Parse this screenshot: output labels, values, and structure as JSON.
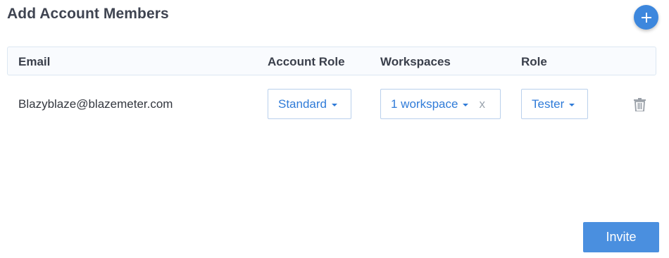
{
  "header": {
    "title": "Add Account Members",
    "add_icon": "plus-icon"
  },
  "table": {
    "columns": [
      "Email",
      "Account Role",
      "Workspaces",
      "Role"
    ],
    "rows": [
      {
        "email": "Blazyblaze@blazemeter.com",
        "account_role": "Standard",
        "workspaces": "1 workspace",
        "workspaces_clear": "x",
        "role": "Tester",
        "delete_icon": "trash-icon"
      }
    ]
  },
  "footer": {
    "invite_label": "Invite"
  },
  "colors": {
    "accent": "#3d87dd",
    "select_text": "#2f7bd8",
    "header_border": "#dce7f2"
  }
}
